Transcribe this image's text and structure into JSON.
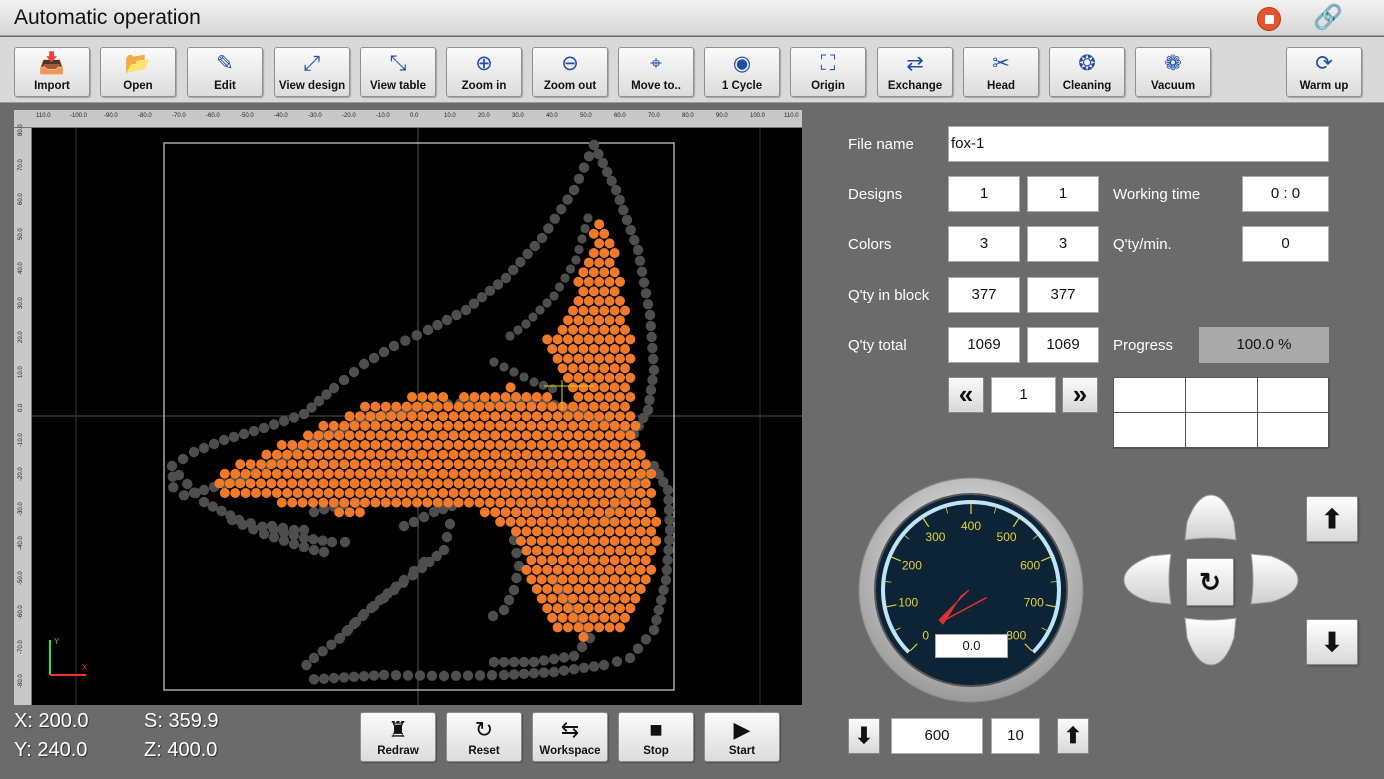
{
  "window": {
    "title": "Automatic operation"
  },
  "toolbar": [
    {
      "label": "Import",
      "icon": "📥",
      "name": "import"
    },
    {
      "label": "Open",
      "icon": "📂",
      "name": "open"
    },
    {
      "label": "Edit",
      "icon": "✎",
      "name": "edit"
    },
    {
      "label": "View design",
      "icon": "⤢",
      "name": "view-design"
    },
    {
      "label": "View table",
      "icon": "⤡",
      "name": "view-table"
    },
    {
      "label": "Zoom in",
      "icon": "⊕",
      "name": "zoom-in"
    },
    {
      "label": "Zoom out",
      "icon": "⊖",
      "name": "zoom-out"
    },
    {
      "label": "Move to..",
      "icon": "⌖",
      "name": "move-to"
    },
    {
      "label": "1 Cycle",
      "icon": "◉",
      "name": "one-cycle"
    },
    {
      "label": "Origin",
      "icon": "⛶",
      "name": "origin"
    },
    {
      "label": "Exchange",
      "icon": "⇄",
      "name": "exchange"
    },
    {
      "label": "Head",
      "icon": "✂",
      "name": "head"
    },
    {
      "label": "Cleaning",
      "icon": "❂",
      "name": "cleaning"
    },
    {
      "label": "Vacuum",
      "icon": "❁",
      "name": "vacuum"
    },
    {
      "label": "Warm up",
      "icon": "⟳",
      "name": "warm-up"
    }
  ],
  "ruler": {
    "top": [
      "110.0",
      "-100.0",
      "-90.0",
      "-80.0",
      "-70.0",
      "-60.0",
      "-50.0",
      "-40.0",
      "-30.0",
      "-20.0",
      "-10.0",
      "0.0",
      "10.0",
      "20.0",
      "30.0",
      "40.0",
      "50.0",
      "60.0",
      "70.0",
      "80.0",
      "90.0",
      "100.0",
      "110.0"
    ],
    "left": [
      "80.0",
      "70.0",
      "60.0",
      "50.0",
      "40.0",
      "30.0",
      "20.0",
      "10.0",
      "0.0",
      "-10.0",
      "-20.0",
      "-30.0",
      "-40.0",
      "-50.0",
      "-60.0",
      "-70.0",
      "-80.0"
    ]
  },
  "axis": {
    "x_label": "X",
    "y_label": "Y"
  },
  "coords": {
    "x": "X: 200.0",
    "y": "Y: 240.0",
    "s": "S: 359.9",
    "z": "Z: 400.0"
  },
  "bottom_buttons": [
    {
      "label": "Redraw",
      "icon": "♜",
      "name": "redraw"
    },
    {
      "label": "Reset",
      "icon": "↻",
      "name": "reset"
    },
    {
      "label": "Workspace",
      "icon": "⇆",
      "name": "workspace"
    },
    {
      "label": "Stop",
      "icon": "■",
      "name": "stop"
    },
    {
      "label": "Start",
      "icon": "▶",
      "name": "start"
    }
  ],
  "info": {
    "file_name_label": "File name",
    "file_name": "fox-1",
    "designs_label": "Designs",
    "designs_a": "1",
    "designs_b": "1",
    "colors_label": "Colors",
    "colors_a": "3",
    "colors_b": "3",
    "qty_block_label": "Q'ty in block",
    "qty_block_a": "377",
    "qty_block_b": "377",
    "qty_total_label": "Q'ty total",
    "qty_total_a": "1069",
    "qty_total_b": "1069",
    "working_time_label": "Working time",
    "working_time": "0 : 0",
    "qty_min_label": "Q'ty/min.",
    "qty_min": "0",
    "progress_label": "Progress",
    "progress": "100.0 %",
    "page": "1"
  },
  "gauge": {
    "ticks": [
      "0",
      "100",
      "200",
      "300",
      "400",
      "500",
      "600",
      "700",
      "800"
    ],
    "value": 0.0,
    "value_text": "0.0",
    "max": 800,
    "colors": {
      "face": "#0d2336",
      "arc": "#bfe3f7",
      "text": "#e6d23a",
      "needle": "#e23030"
    }
  },
  "speed": {
    "value": "600",
    "step": "10"
  },
  "colors": {
    "fill": "#f07a2a",
    "outline": "#4e4e4e",
    "frame": "#d0d0d0"
  }
}
